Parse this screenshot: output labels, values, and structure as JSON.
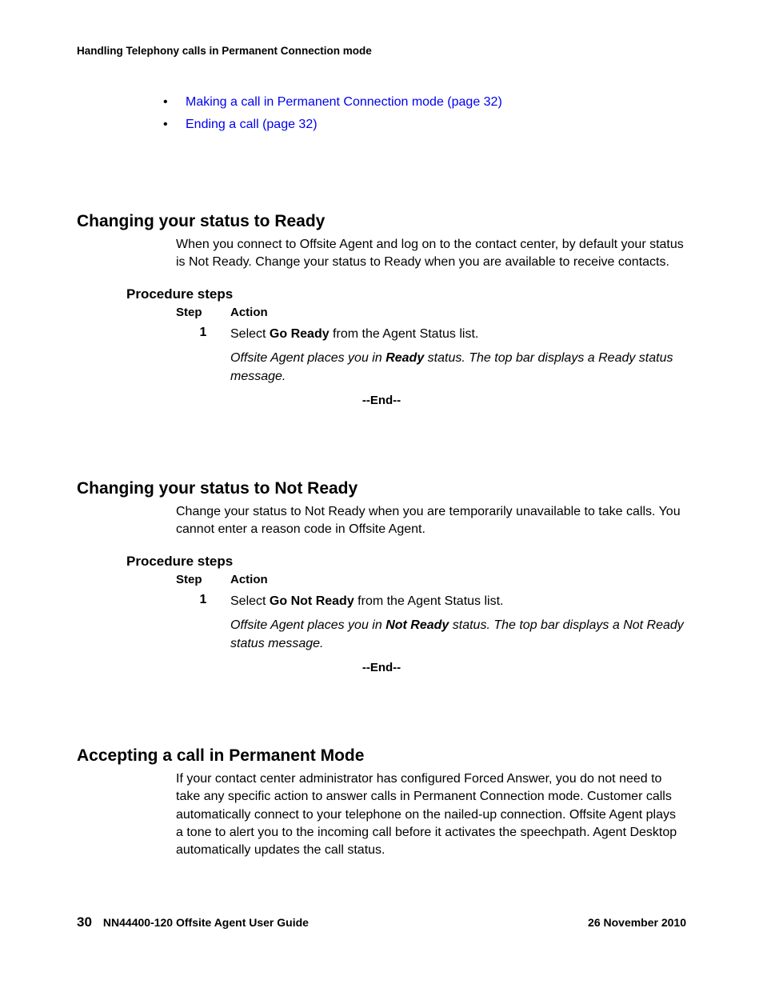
{
  "running_header": "Handling Telephony calls in Permanent Connection mode",
  "bullets": [
    "Making a call in Permanent Connection mode (page 32)",
    "Ending a call (page 32)"
  ],
  "section1": {
    "heading": "Changing your status to Ready",
    "body": "When you connect to Offsite Agent and log on to the contact center, by default your status is Not Ready. Change your status to Ready when you are available to receive contacts.",
    "subheading": "Procedure steps",
    "col_step": "Step",
    "col_action": "Action",
    "step_num": "1",
    "step_pre": "Select ",
    "step_bold": "Go Ready",
    "step_post": " from the Agent Status list.",
    "note_pre": "Offsite Agent places you in ",
    "note_bold": "Ready",
    "note_post": " status. The top bar displays a Ready status message.",
    "end": "--End--"
  },
  "section2": {
    "heading": "Changing your status to Not Ready",
    "body": "Change your status to Not Ready when you are temporarily unavailable to take calls. You cannot enter a reason code in Offsite Agent.",
    "subheading": "Procedure steps",
    "col_step": "Step",
    "col_action": "Action",
    "step_num": "1",
    "step_pre": "Select ",
    "step_bold": "Go Not Ready",
    "step_post": " from the Agent Status list.",
    "note_pre": "Offsite Agent places you in ",
    "note_bold": "Not Ready",
    "note_post": " status. The top bar displays a Not Ready status message.",
    "end": "--End--"
  },
  "section3": {
    "heading": "Accepting a call in Permanent Mode",
    "body": "If your contact center administrator has configured Forced Answer, you do not need to take any specific action to answer calls in Permanent Connection mode. Customer calls automatically connect to your telephone on the nailed-up connection. Offsite Agent plays a tone to alert you to the incoming call before it activates the speechpath. Agent Desktop automatically updates the call status."
  },
  "footer": {
    "page_num": "30",
    "doc_title": "NN44400-120 Offsite Agent User Guide",
    "date": "26 November 2010"
  }
}
